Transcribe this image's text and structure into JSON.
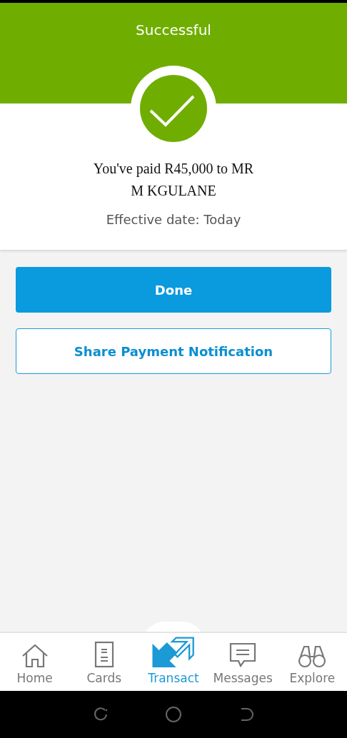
{
  "header": {
    "title": "Successful"
  },
  "confirmation": {
    "message": "You've paid R45,000 to MR M KGULANE",
    "effective_date": "Effective date: Today"
  },
  "buttons": [
    {
      "label": "Done",
      "kind": "primary"
    },
    {
      "label": "Share Payment Notification",
      "kind": "secondary"
    }
  ],
  "bottom_nav": [
    {
      "label": "Home",
      "kind": "home",
      "selected": false
    },
    {
      "label": "Cards",
      "kind": "cards",
      "selected": false
    },
    {
      "label": "Transact",
      "kind": "transact",
      "selected": true
    },
    {
      "label": "Messages",
      "kind": "messages",
      "selected": false
    },
    {
      "label": "Explore",
      "kind": "explore",
      "selected": false
    }
  ]
}
